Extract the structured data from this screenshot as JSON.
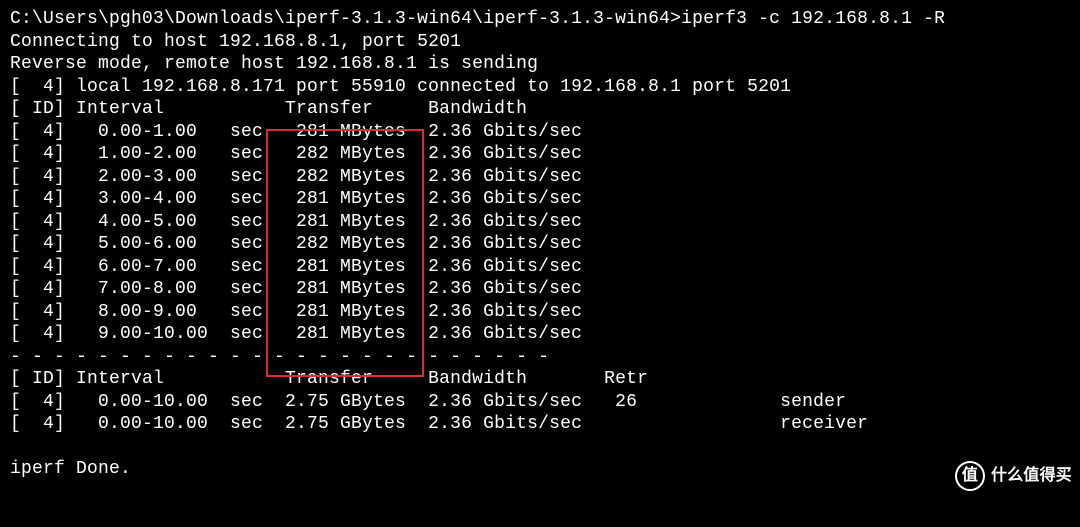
{
  "prompt": "C:\\Users\\pgh03\\Downloads\\iperf-3.1.3-win64\\iperf-3.1.3-win64>",
  "command": "iperf3 -c 192.168.8.1 -R",
  "connecting_line": "Connecting to host 192.168.8.1, port 5201",
  "reverse_line": "Reverse mode, remote host 192.168.8.1 is sending",
  "local_line": "[  4] local 192.168.8.171 port 55910 connected to 192.168.8.1 port 5201",
  "header": "[ ID] Interval           Transfer     Bandwidth",
  "rows": [
    "[  4]   0.00-1.00   sec   281 MBytes  2.36 Gbits/sec",
    "[  4]   1.00-2.00   sec   282 MBytes  2.36 Gbits/sec",
    "[  4]   2.00-3.00   sec   282 MBytes  2.36 Gbits/sec",
    "[  4]   3.00-4.00   sec   281 MBytes  2.36 Gbits/sec",
    "[  4]   4.00-5.00   sec   281 MBytes  2.36 Gbits/sec",
    "[  4]   5.00-6.00   sec   282 MBytes  2.36 Gbits/sec",
    "[  4]   6.00-7.00   sec   281 MBytes  2.36 Gbits/sec",
    "[  4]   7.00-8.00   sec   281 MBytes  2.36 Gbits/sec",
    "[  4]   8.00-9.00   sec   281 MBytes  2.36 Gbits/sec",
    "[  4]   9.00-10.00  sec   281 MBytes  2.36 Gbits/sec"
  ],
  "dashes": "- - - - - - - - - - - - - - - - - - - - - - - - -",
  "summary_header": "[ ID] Interval           Transfer     Bandwidth       Retr",
  "summary_sender": "[  4]   0.00-10.00  sec  2.75 GBytes  2.36 Gbits/sec   26             sender",
  "summary_receiver": "[  4]   0.00-10.00  sec  2.75 GBytes  2.36 Gbits/sec                  receiver",
  "done_line": "iperf Done.",
  "watermark": {
    "logo": "值",
    "text": "什么值得买"
  }
}
